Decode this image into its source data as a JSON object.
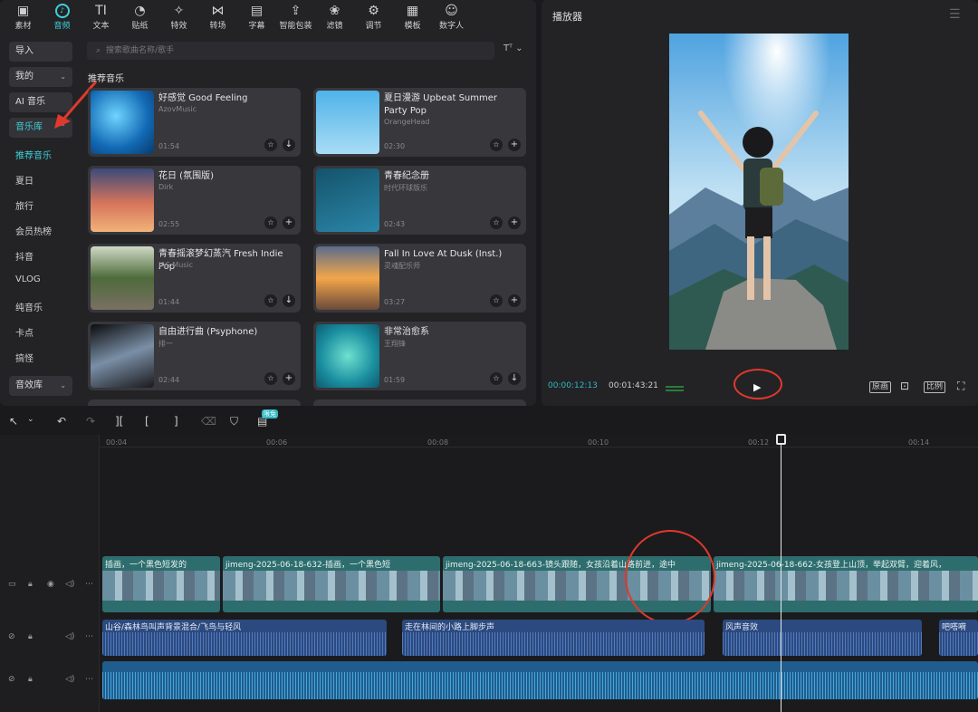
{
  "toolbar": {
    "items": [
      {
        "icon": "media-icon",
        "glyph": "▣",
        "label": "素材"
      },
      {
        "icon": "audio-icon",
        "glyph": "♪",
        "label": "音频"
      },
      {
        "icon": "text-icon",
        "glyph": "TI",
        "label": "文本"
      },
      {
        "icon": "sticker-icon",
        "glyph": "◔",
        "label": "贴纸"
      },
      {
        "icon": "effects-icon",
        "glyph": "✧",
        "label": "特效"
      },
      {
        "icon": "transition-icon",
        "glyph": "⋈",
        "label": "转场"
      },
      {
        "icon": "caption-icon",
        "glyph": "▤",
        "label": "字幕"
      },
      {
        "icon": "smart-pack-icon",
        "glyph": "⇪",
        "label": "智能包装"
      },
      {
        "icon": "filter-icon",
        "glyph": "❀",
        "label": "滤镜"
      },
      {
        "icon": "adjust-icon",
        "glyph": "⚙",
        "label": "调节"
      },
      {
        "icon": "template-icon",
        "glyph": "▦",
        "label": "模板"
      },
      {
        "icon": "digital-human-icon",
        "glyph": "☺",
        "label": "数字人"
      }
    ],
    "active_index": 1
  },
  "sidebar": {
    "buttons": [
      {
        "label": "导入"
      },
      {
        "label": "我的",
        "chevron": "⌄"
      },
      {
        "label": "AI 音乐"
      },
      {
        "label": "音乐库",
        "chevron": "⌃"
      }
    ],
    "links": [
      "推荐音乐",
      "夏日",
      "旅行",
      "会员热榜",
      "抖音",
      "VLOG",
      "纯音乐",
      "卡点",
      "搞怪"
    ],
    "bottom_button": {
      "label": "音效库",
      "chevron": "⌄"
    }
  },
  "search": {
    "placeholder": "搜索歌曲名称/歌手",
    "filter_label": "Tᵀ ⌄"
  },
  "section_title": "推荐音乐",
  "songs": [
    {
      "title": "好感觉  Good Feeling",
      "artist": "AzovMusic",
      "duration": "01:54",
      "action": "↓"
    },
    {
      "title": "夏日漫游 Upbeat Summer Party Pop",
      "artist": "OrangeHead",
      "duration": "02:30",
      "action": "+"
    },
    {
      "title": "花日 (氛围版)",
      "artist": "Dirk",
      "duration": "02:55",
      "action": "+"
    },
    {
      "title": "青春纪念册",
      "artist": "时代环球版乐",
      "duration": "02:43",
      "action": "+"
    },
    {
      "title": "青春摇滚梦幻蒸汽 Fresh Indie Pop",
      "artist": "JAS Music",
      "duration": "01:44",
      "action": "↓"
    },
    {
      "title": "Fall In Love At Dusk (Inst.)",
      "artist": "灵魂配乐师",
      "duration": "03:27",
      "action": "+"
    },
    {
      "title": "自由进行曲 (Psyphone)",
      "artist": "排一",
      "duration": "02:44",
      "action": "+"
    },
    {
      "title": "非常治愈系",
      "artist": "王翔锋",
      "duration": "01:59",
      "action": "↓"
    }
  ],
  "player": {
    "title": "播放器",
    "current_time": "00:00:12:13",
    "total_time": "00:01:43:21",
    "controls": [
      "原画",
      "⊡",
      "比例",
      "⛶"
    ]
  },
  "timeline_toolbar": {
    "tools": [
      "↖",
      "⌄",
      "↶",
      "↷",
      "][",
      "[",
      "]",
      "⌫",
      "⛉",
      "▤"
    ],
    "badge": "限免"
  },
  "ruler": [
    "00:04",
    "00:06",
    "00:08",
    "00:10",
    "00:12",
    "00:14"
  ],
  "video_clips": [
    {
      "label": "插画，一个黑色短发的"
    },
    {
      "label": "jimeng-2025-06-18-632-插画，一个黑色短"
    },
    {
      "label": "jimeng-2025-06-18-663-镜头跟随，女孩沿着山路前进，途中"
    },
    {
      "label": "jimeng-2025-06-18-662-女孩登上山顶，举起双臂，迎着风，"
    }
  ],
  "audio_clips": [
    {
      "label": "山谷/森林鸟叫声背景混合/飞鸟与轻风"
    },
    {
      "label": "走在林间的小路上脚步声"
    },
    {
      "label": "风声音效"
    },
    {
      "label": "吧嗒嗬"
    }
  ],
  "colors": {
    "accent": "#3fd0d8",
    "annotation": "#e0392c",
    "video_track": "#2d6d6e",
    "audio_track": "#2c4a7f",
    "music_track": "#1f5d8f"
  }
}
